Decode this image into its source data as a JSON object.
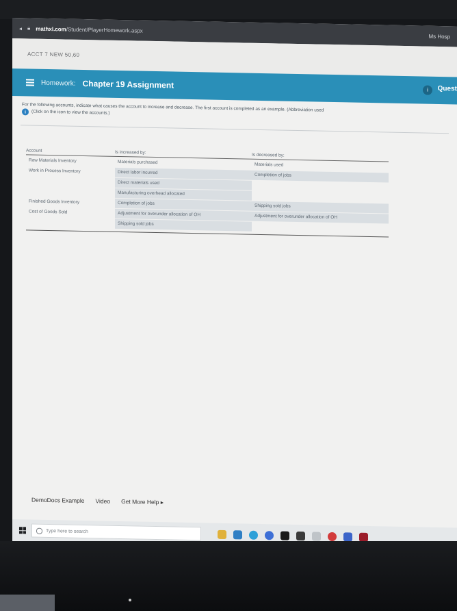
{
  "browser": {
    "url_host": "mathxl.com",
    "url_path": "/Student/PlayerHomework.aspx",
    "window_right": "Ms Hosp"
  },
  "course": {
    "code": "ACCT 7 NEW 50,60"
  },
  "header": {
    "menu_label": "Homework:",
    "title": "Chapter 19 Assignment",
    "question_badge": "i",
    "question_label": "Quest"
  },
  "instructions": {
    "line1": "For the following accounts, indicate what causes the account to increase and decrease. The first account is completed as an example. (Abbreviation used",
    "line2": "(Click on the icon to view the accounts.)",
    "info_icon_label": "i"
  },
  "table": {
    "headers": [
      "Account",
      "Is increased by:",
      "Is decreased by:"
    ],
    "rows": [
      {
        "account": "Raw Materials Inventory",
        "increase": "Materials purchased",
        "decrease": "Materials used",
        "shade_inc": false,
        "shade_dec": false
      },
      {
        "account": "Work in Process Inventory",
        "increase": "Direct labor incurred",
        "decrease": "Completion of jobs",
        "shade_inc": true,
        "shade_dec": true
      },
      {
        "account": "",
        "increase": "Direct materials used",
        "decrease": "",
        "shade_inc": true,
        "shade_dec": false
      },
      {
        "account": "",
        "increase": "Manufacturing overhead allocated",
        "decrease": "",
        "shade_inc": true,
        "shade_dec": false
      },
      {
        "account": "Finished Goods Inventory",
        "increase": "Completion of jobs",
        "decrease": "Shipping sold jobs",
        "shade_inc": true,
        "shade_dec": true
      },
      {
        "account": "Cost of Goods Sold",
        "increase": "Adjustment for overunder allocation of OH",
        "decrease": "Adjustment for overunder allocation of OH",
        "shade_inc": true,
        "shade_dec": true
      },
      {
        "account": "",
        "increase": "Shipping sold jobs",
        "decrease": "",
        "shade_inc": true,
        "shade_dec": false
      }
    ]
  },
  "footer": {
    "demo": "DemoDocs Example",
    "video": "Video",
    "help": "Get More Help ▸"
  },
  "taskbar": {
    "search_placeholder": "Type here to search",
    "icons": [
      "file-explorer-icon",
      "edge-icon",
      "chrome-icon",
      "teams-icon",
      "photos-icon",
      "store-icon",
      "mail-icon",
      "opera-icon",
      "word-icon",
      "app-icon"
    ]
  },
  "colors": {
    "accent": "#2a8fb8",
    "shade": "#d9dee2"
  }
}
